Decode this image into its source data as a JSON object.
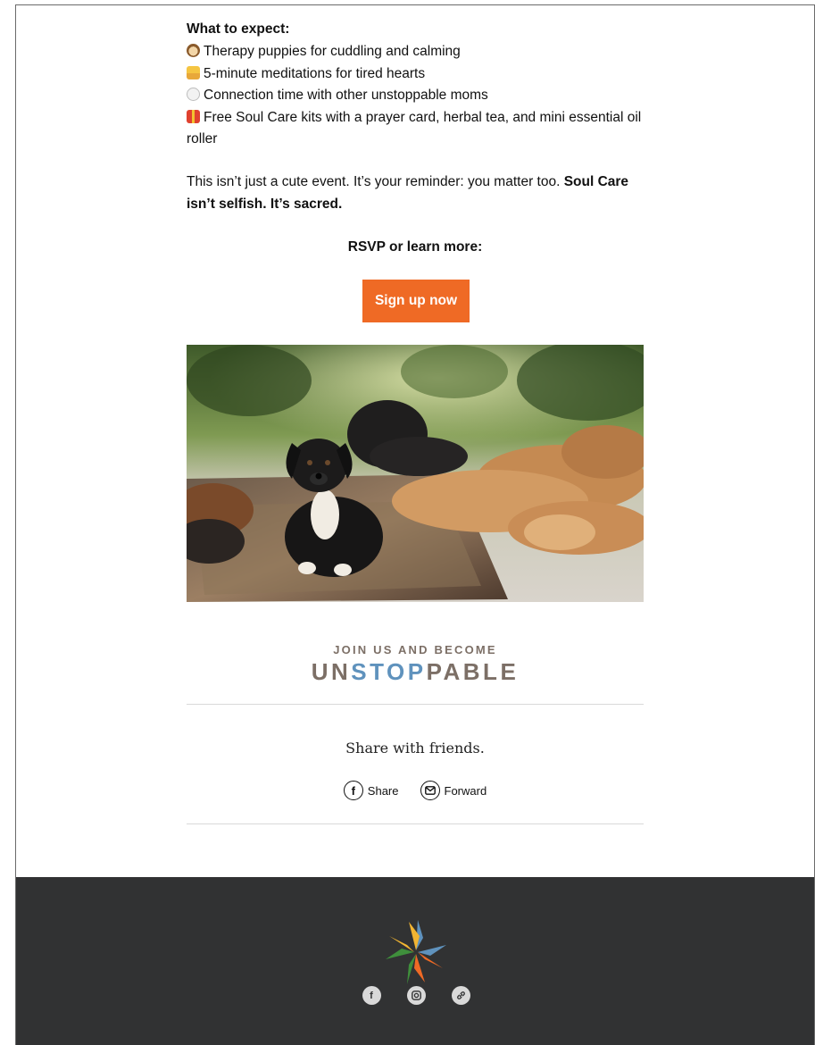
{
  "expect": {
    "title": "What to expect:",
    "items": [
      {
        "icon": "puppy-emoji-icon",
        "text": "Therapy puppies for cuddling and calming"
      },
      {
        "icon": "meditation-emoji-icon",
        "text": "5-minute meditations for tired hearts"
      },
      {
        "icon": "speech-bubble-emoji-icon",
        "text": "Connection time with other unstoppable moms"
      },
      {
        "icon": "gift-emoji-icon",
        "text": "Free Soul Care kits with a prayer card, herbal tea, and mini essential oil roller"
      }
    ]
  },
  "message": {
    "text": "This isn’t just a cute event. It’s your reminder: you matter too. ",
    "bold": "Soul Care isn’t selfish. It’s sacred."
  },
  "rsvp": {
    "label": "RSVP or learn more:",
    "button": "Sign up now"
  },
  "photo": {
    "icon": "puppies-photo"
  },
  "brand": {
    "tagline": "JOIN US AND BECOME",
    "word_part1": "UN",
    "word_part2": "STOP",
    "word_part3": "PABLE",
    "color_main": "#7c6f66",
    "color_accent": "#5f92bd"
  },
  "share": {
    "title": "Share with friends.",
    "share_label": "Share",
    "forward_label": "Forward"
  },
  "footer": {
    "background": "#313233",
    "social_icons": [
      "facebook-icon",
      "instagram-icon",
      "link-icon"
    ]
  },
  "colors": {
    "button": "#ef6a25"
  }
}
